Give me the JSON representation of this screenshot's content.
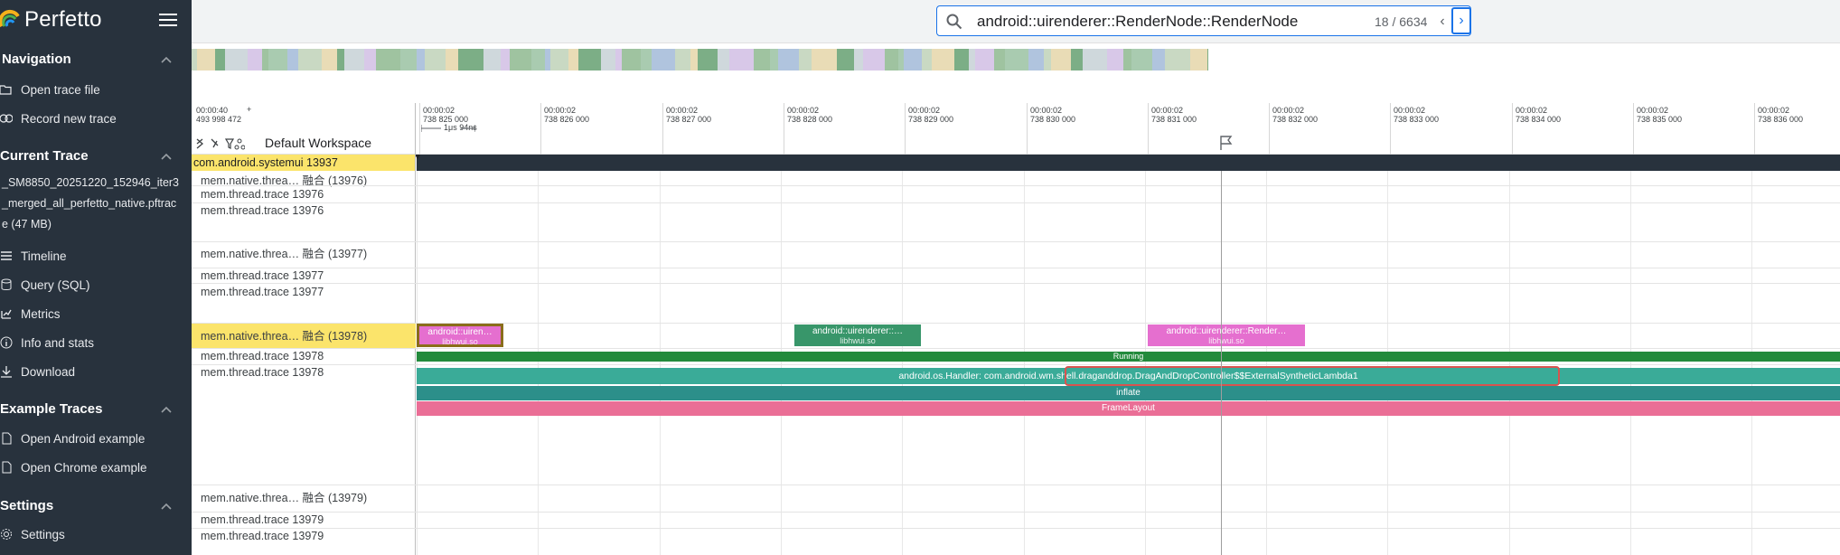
{
  "app": {
    "title": "Perfetto"
  },
  "sidebar": {
    "navigation": {
      "title": "Navigation",
      "items": [
        {
          "label": "Open trace file"
        },
        {
          "label": "Record new trace"
        }
      ]
    },
    "current_trace": {
      "title": "Current Trace",
      "file": "_SM8850_20251220_152946_iter3_merged_all_perfetto_native.pftrace (47 MB)",
      "items": [
        {
          "label": "Timeline"
        },
        {
          "label": "Query (SQL)"
        },
        {
          "label": "Metrics"
        },
        {
          "label": "Info and stats"
        },
        {
          "label": "Download"
        }
      ]
    },
    "examples": {
      "title": "Example Traces",
      "items": [
        {
          "label": "Open Android example"
        },
        {
          "label": "Open Chrome example"
        }
      ]
    },
    "settings": {
      "title": "Settings",
      "items": [
        {
          "label": "Settings"
        }
      ]
    }
  },
  "search": {
    "query": "android::uirenderer::RenderNode::RenderNode",
    "count": "18 / 6634",
    "prev": "‹",
    "next": "›"
  },
  "timeline": {
    "start_time": "00:00:40\n493 998 472",
    "plus": "+",
    "span": "1μs 94ns",
    "workspace": "Default Workspace",
    "ticks": [
      "00:00:02\n738 825 000",
      "00:00:02\n738 826 000",
      "00:00:02\n738 827 000",
      "00:00:02\n738 828 000",
      "00:00:02\n738 829 000",
      "00:00:02\n738 830 000",
      "00:00:02\n738 831 000",
      "00:00:02\n738 832 000",
      "00:00:02\n738 833 000",
      "00:00:02\n738 834 000",
      "00:00:02\n738 835 000",
      "00:00:02\n738 836 000"
    ]
  },
  "tracks": {
    "process": "com.android.systemui 13937",
    "names": [
      "mem.native.threa… 融合 (13976)",
      "mem.thread.trace 13976",
      "mem.thread.trace 13976",
      "mem.native.threa… 融合 (13977)",
      "mem.thread.trace 13977",
      "mem.thread.trace 13977",
      "mem.native.threa… 融合 (13978)",
      "mem.thread.trace 13978",
      "mem.thread.trace 13978",
      "mem.native.threa… 融合 (13979)",
      "mem.thread.trace 13979",
      "mem.thread.trace 13979"
    ]
  },
  "slices": {
    "s1": {
      "name": "android::uiren…",
      "lib": "libhwui.so"
    },
    "s2": {
      "name": "android::uirenderer::…",
      "lib": "libhwui.so"
    },
    "s3": {
      "name": "android::uirenderer::Render…",
      "lib": "libhwui.so"
    },
    "running": "Running",
    "handler": "android.os.Handler: com.android.wm.shell.draganddrop.DragAndDropController$$ExternalSyntheticLambda1",
    "inflate": "inflate",
    "framelayout": "FrameLayout"
  },
  "colors": {
    "sidebar_bg": "#28323d",
    "selected_track": "#fbe46b",
    "accent": "#1a73e8",
    "pink": "#e56fcf",
    "green": "#38966a",
    "teal": "#3aab98",
    "running": "#238a3c",
    "inflate": "#2c8f8a",
    "framelayout": "#ea6e96",
    "highlight": "#d9534f"
  }
}
